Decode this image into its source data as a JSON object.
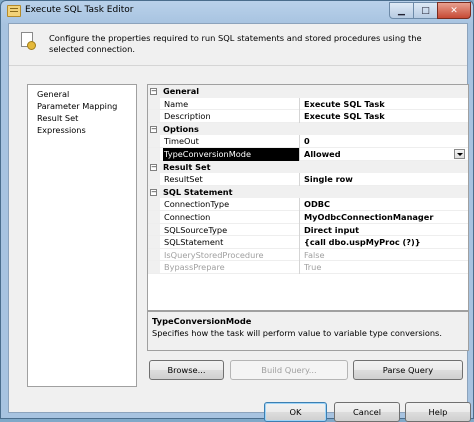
{
  "window": {
    "title": "Execute SQL Task Editor"
  },
  "header": {
    "text": "Configure the properties required to run SQL statements and stored procedures using the selected connection."
  },
  "nav": {
    "items": [
      "General",
      "Parameter Mapping",
      "Result Set",
      "Expressions"
    ]
  },
  "grid": {
    "general": {
      "label": "General",
      "toggle": "−",
      "props": [
        {
          "name": "Name",
          "value": "Execute SQL Task"
        },
        {
          "name": "Description",
          "value": "Execute SQL Task"
        }
      ]
    },
    "options": {
      "label": "Options",
      "toggle": "−",
      "props": [
        {
          "name": "TimeOut",
          "value": "0"
        },
        {
          "name": "TypeConversionMode",
          "value": "Allowed"
        }
      ]
    },
    "result": {
      "label": "Result Set",
      "toggle": "−",
      "props": [
        {
          "name": "ResultSet",
          "value": "Single row"
        }
      ]
    },
    "sql": {
      "label": "SQL Statement",
      "toggle": "−",
      "props": [
        {
          "name": "ConnectionType",
          "value": "ODBC"
        },
        {
          "name": "Connection",
          "value": "MyOdbcConnectionManager"
        },
        {
          "name": "SQLSourceType",
          "value": "Direct input"
        },
        {
          "name": "SQLStatement",
          "value": "{call dbo.uspMyProc (?)}"
        },
        {
          "name": "IsQueryStoredProcedure",
          "value": "False"
        },
        {
          "name": "BypassPrepare",
          "value": "True"
        }
      ]
    }
  },
  "description": {
    "title": "TypeConversionMode",
    "text": "Specifies how the task will perform value to variable type conversions."
  },
  "buttons": {
    "browse": "Browse...",
    "build_query": "Build Query...",
    "parse_query": "Parse Query",
    "ok": "OK",
    "cancel": "Cancel",
    "help": "Help"
  }
}
